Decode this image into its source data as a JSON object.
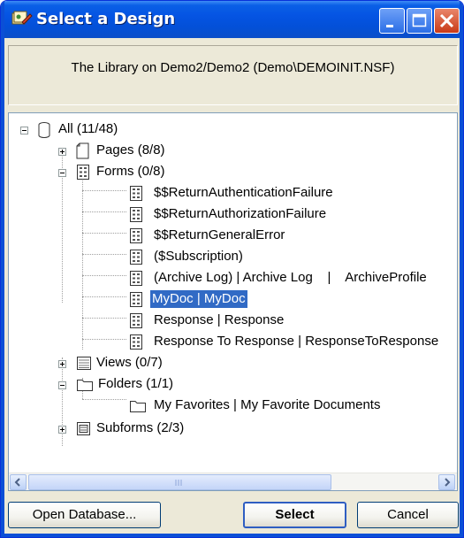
{
  "window": {
    "title": "Select a Design",
    "icon": "design-icon"
  },
  "titlebar_buttons": {
    "minimize": "minimize-icon",
    "maximize": "maximize-icon",
    "close": "close-icon"
  },
  "header": {
    "text": "The Library on Demo2/Demo2 (Demo\\DEMOINIT.NSF)"
  },
  "tree": {
    "root": {
      "label": "All (11/48)",
      "icon": "database-icon",
      "expanded": true
    },
    "pages": {
      "label": "Pages (8/8)",
      "icon": "page-icon",
      "expanded": false
    },
    "forms": {
      "label": "Forms (0/8)",
      "icon": "form-icon",
      "expanded": true
    },
    "form_items": [
      {
        "label": "$$ReturnAuthenticationFailure"
      },
      {
        "label": "$$ReturnAuthorizationFailure"
      },
      {
        "label": "$$ReturnGeneralError"
      },
      {
        "label": "($Subscription)"
      },
      {
        "label": "(Archive Log) | Archive Log    |    ArchiveProfile"
      },
      {
        "label": "MyDoc | MyDoc",
        "selected": true
      },
      {
        "label": "Response | Response"
      },
      {
        "label": "Response To Response | ResponseToResponse"
      }
    ],
    "views": {
      "label": "Views (0/7)",
      "icon": "view-icon",
      "expanded": false
    },
    "folders": {
      "label": "Folders (1/1)",
      "icon": "folder-icon",
      "expanded": true
    },
    "folder_items": [
      {
        "label": "My Favorites | My Favorite Documents"
      }
    ],
    "subforms": {
      "label": "Subforms (2/3)",
      "icon": "subform-icon",
      "expanded": false
    }
  },
  "scrollbar": {
    "position": 0.0
  },
  "buttons": {
    "open_database": "Open Database...",
    "select": "Select",
    "cancel": "Cancel"
  },
  "colors": {
    "titlebar": "#0554e3",
    "selection": "#316ac5",
    "dialog_bg": "#ece9d8"
  }
}
